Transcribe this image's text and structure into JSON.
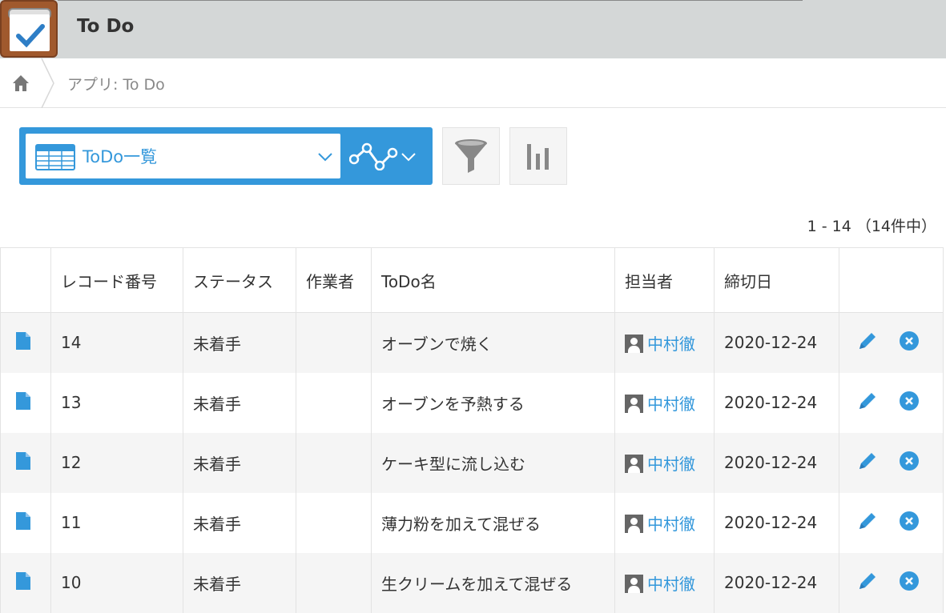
{
  "app": {
    "title": "To Do"
  },
  "breadcrumb": {
    "text": "アプリ: To Do"
  },
  "view": {
    "name": "ToDo一覧"
  },
  "pager": {
    "text": "1 - 14 （14件中）"
  },
  "columns": [
    "レコード番号",
    "ステータス",
    "作業者",
    "ToDo名",
    "担当者",
    "締切日"
  ],
  "rows": [
    {
      "id": "14",
      "status": "未着手",
      "worker": "",
      "name": "オーブンで焼く",
      "assignee": "中村徹",
      "deadline": "2020-12-24"
    },
    {
      "id": "13",
      "status": "未着手",
      "worker": "",
      "name": "オーブンを予熱する",
      "assignee": "中村徹",
      "deadline": "2020-12-24"
    },
    {
      "id": "12",
      "status": "未着手",
      "worker": "",
      "name": "ケーキ型に流し込む",
      "assignee": "中村徹",
      "deadline": "2020-12-24"
    },
    {
      "id": "11",
      "status": "未着手",
      "worker": "",
      "name": "薄力粉を加えて混ぜる",
      "assignee": "中村徹",
      "deadline": "2020-12-24"
    },
    {
      "id": "10",
      "status": "未着手",
      "worker": "",
      "name": "生クリームを加えて混ぜる",
      "assignee": "中村徹",
      "deadline": "2020-12-24"
    }
  ],
  "colors": {
    "accent": "#3498db",
    "header_bg": "#d4d7d7",
    "row_stripe": "#f5f5f5"
  },
  "icons": [
    "app-todo-icon",
    "home-icon",
    "table-icon",
    "chevron-down-icon",
    "graph-icon",
    "filter-icon",
    "bar-chart-icon",
    "document-icon",
    "user-icon",
    "pencil-icon",
    "close-circle-icon"
  ]
}
